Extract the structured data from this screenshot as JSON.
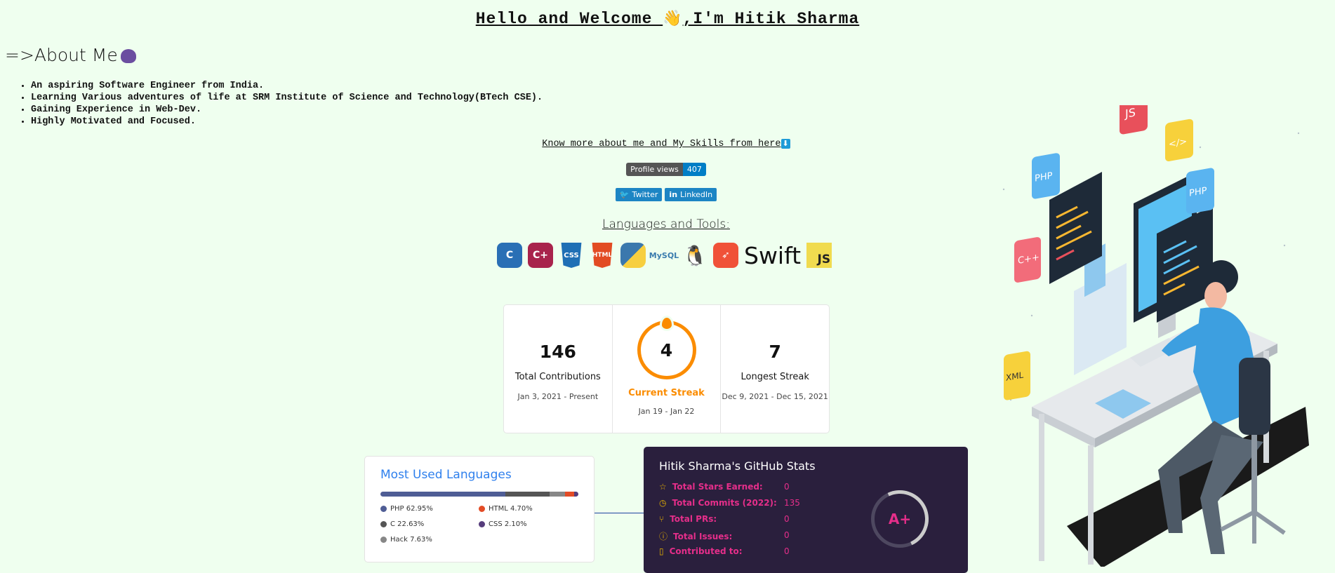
{
  "header": {
    "title_pre": "Hello and Welcome ",
    "wave": "👋",
    "title_post": ",I'm Hitik Sharma"
  },
  "about": {
    "heading": "=>About Me",
    "items": [
      "An aspiring Software Engineer from India.",
      "Learning Various adventures of life at SRM Institute of Science and Technology(BTech CSE).",
      "Gaining Experience in Web-Dev.",
      "Highly Motivated and Focused."
    ]
  },
  "know_more": {
    "text": "Know more about me and My Skills from here",
    "arrow": "⬇"
  },
  "profile_views": {
    "label": "Profile views",
    "count": "407"
  },
  "social": {
    "twitter": "Twitter",
    "linkedin": "LinkedIn"
  },
  "languages_tools": {
    "heading": "Languages and Tools:",
    "icons": [
      "c-icon",
      "cplusplus-icon",
      "css3-icon",
      "html5-icon",
      "python-icon",
      "mysql-icon",
      "linux-icon",
      "swift-icon",
      "javascript-icon"
    ],
    "c": "C",
    "cpp": "C+",
    "css": "CSS",
    "html": "HTML",
    "mysql": "MySQL",
    "swift_word": "Swift",
    "js": "JS"
  },
  "streak": {
    "total": {
      "value": "146",
      "label": "Total Contributions",
      "range": "Jan 3, 2021 - Present"
    },
    "current": {
      "value": "4",
      "label": "Current Streak",
      "range": "Jan 19 - Jan 22"
    },
    "longest": {
      "value": "7",
      "label": "Longest Streak",
      "range": "Dec 9, 2021 - Dec 15, 2021"
    },
    "accent": "#fb8c00"
  },
  "most_used": {
    "title": "Most Used Languages",
    "langs": [
      {
        "name": "PHP 62.95%",
        "pct": 62.95,
        "color": "#4f5d95"
      },
      {
        "name": "C 22.63%",
        "pct": 22.63,
        "color": "#555555"
      },
      {
        "name": "Hack 7.63%",
        "pct": 7.63,
        "color": "#878787"
      },
      {
        "name": "HTML 4.70%",
        "pct": 4.7,
        "color": "#e34c26"
      },
      {
        "name": "CSS 2.10%",
        "pct": 2.1,
        "color": "#563d7c"
      }
    ]
  },
  "github_stats": {
    "title": "Hitik Sharma's GitHub Stats",
    "rows": [
      {
        "icon": "☆",
        "label": "Total Stars Earned:",
        "value": "0"
      },
      {
        "icon": "◷",
        "label": "Total Commits (2022):",
        "value": "135"
      },
      {
        "icon": "⑂",
        "label": "Total PRs:",
        "value": "0"
      },
      {
        "icon": "ⓘ",
        "label": "Total Issues:",
        "value": "0"
      },
      {
        "icon": "▯",
        "label": "Contributed to:",
        "value": "0"
      }
    ],
    "grade": "A+"
  }
}
